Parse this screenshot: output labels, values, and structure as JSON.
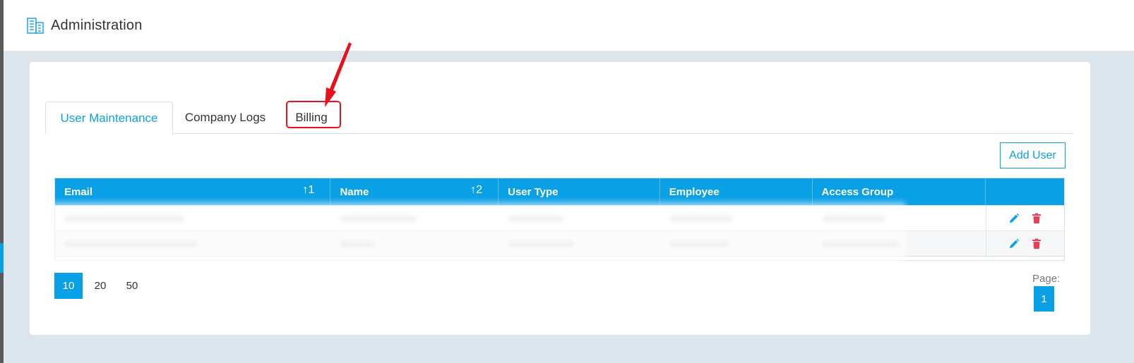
{
  "header": {
    "title": "Administration",
    "icon": "building-icon"
  },
  "tabs": [
    {
      "label": "User Maintenance",
      "active": true
    },
    {
      "label": "Company Logs",
      "active": false
    },
    {
      "label": "Billing",
      "active": false,
      "highlighted": true
    }
  ],
  "toolbar": {
    "add_user_label": "Add User"
  },
  "table": {
    "columns": [
      {
        "label": "Email",
        "sort": "↑1"
      },
      {
        "label": "Name",
        "sort": "↑2"
      },
      {
        "label": "User Type",
        "sort": ""
      },
      {
        "label": "Employee",
        "sort": ""
      },
      {
        "label": "Access Group",
        "sort": ""
      },
      {
        "label": "",
        "sort": ""
      }
    ],
    "row_actions": [
      "edit-icon",
      "delete-icon"
    ]
  },
  "pagination": {
    "sizes": [
      "10",
      "20",
      "50"
    ],
    "active_size": "10",
    "page_label": "Page:",
    "current_page": "1"
  },
  "colors": {
    "accent": "#0aa0e6",
    "delete": "#e8405a",
    "annotation": "#e8101a"
  }
}
